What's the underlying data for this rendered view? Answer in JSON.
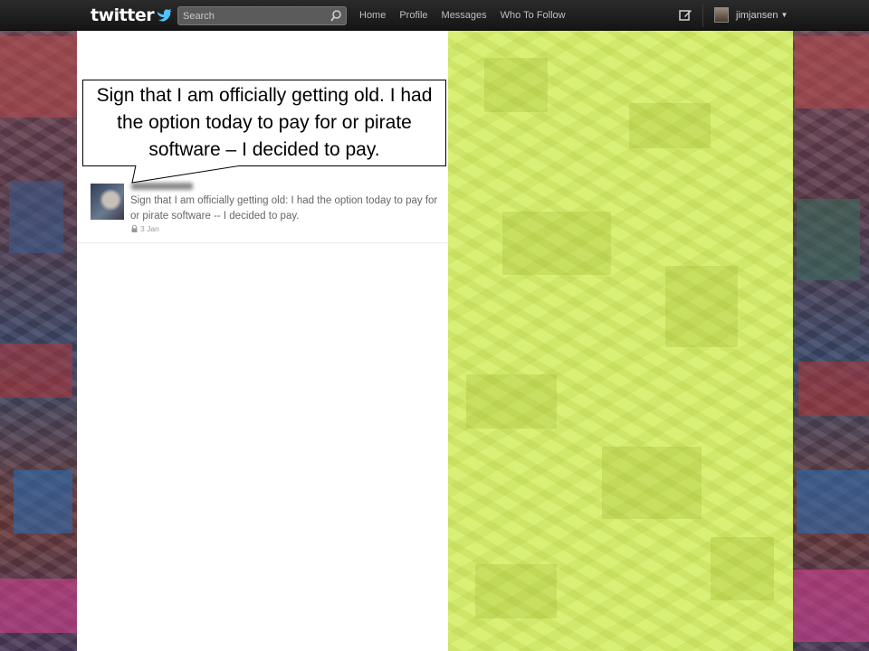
{
  "topbar": {
    "logo_text": "twitter",
    "search_placeholder": "Search",
    "nav": [
      {
        "label": "Home"
      },
      {
        "label": "Profile"
      },
      {
        "label": "Messages"
      },
      {
        "label": "Who To Follow"
      }
    ],
    "username": "jimjansen",
    "icons": [
      "twitter-bird-icon",
      "search-icon",
      "compose-icon",
      "chevron-down-icon"
    ]
  },
  "callout": {
    "text": "Sign that I am officially getting old. I had the option today to pay for or pirate software – I decided to pay."
  },
  "tweet": {
    "text": "Sign that I am officially getting old: I had the option today to pay for or pirate software -- I decided to pay.",
    "date": "3 Jan",
    "icons": [
      "lock-icon"
    ]
  },
  "colors": {
    "topbar": "#1f1f1f",
    "side_panel": "#d8f076",
    "timeline_bg": "#ffffff"
  }
}
